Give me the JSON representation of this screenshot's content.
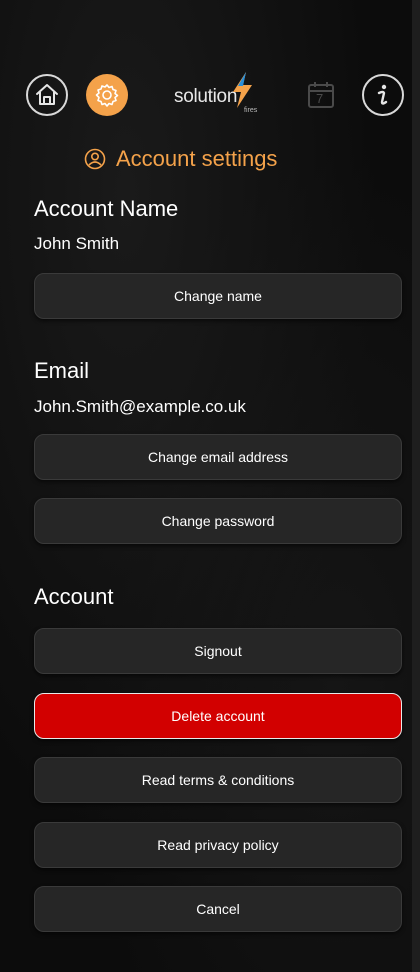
{
  "nav": {
    "home_icon": "home-icon",
    "settings_icon": "gear-icon",
    "calendar_icon": "calendar-icon",
    "calendar_day": "7",
    "info_icon": "info-icon",
    "logo_text": "solution",
    "logo_sub": "fires",
    "accent": "#f4a24a"
  },
  "header": {
    "icon": "user-circle-icon",
    "title": "Account settings"
  },
  "account_name": {
    "heading": "Account Name",
    "value": "John Smith",
    "change_label": "Change name"
  },
  "email": {
    "heading": "Email",
    "value": "John.Smith@example.co.uk",
    "change_label": "Change email address",
    "password_label": "Change password"
  },
  "account": {
    "heading": "Account",
    "signout_label": "Signout",
    "delete_label": "Delete account",
    "terms_label": "Read terms & conditions",
    "privacy_label": "Read privacy policy",
    "cancel_label": "Cancel",
    "danger_color": "#d20000"
  }
}
